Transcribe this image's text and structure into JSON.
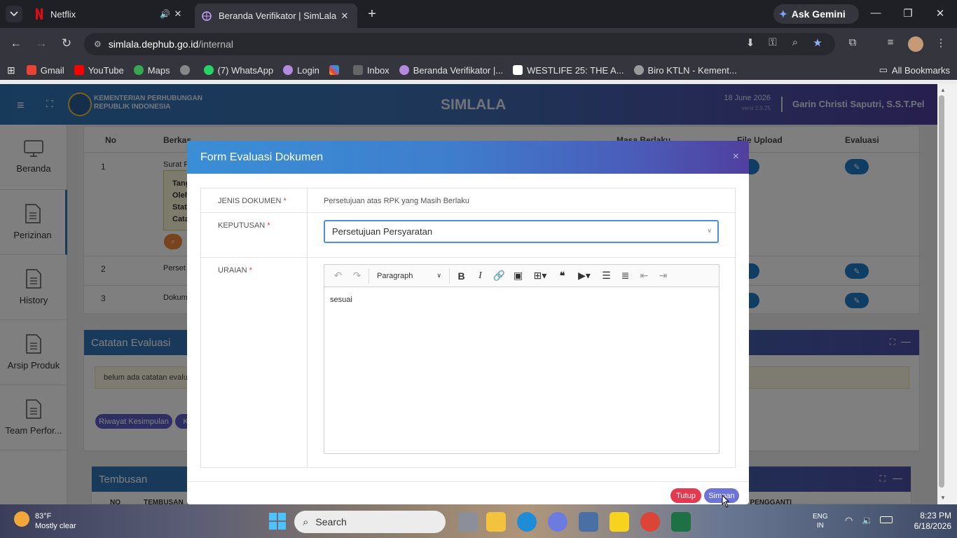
{
  "browser": {
    "tabs": [
      {
        "title": "Netflix",
        "audio": true
      },
      {
        "title": "Beranda Verifikator | SimLala",
        "active": true
      }
    ],
    "gemini_label": "Ask Gemini",
    "url_host": "simlala.dephub.go.id",
    "url_path": "/internal",
    "bookmarks": [
      "Gmail",
      "YouTube",
      "Maps",
      "",
      "(7) WhatsApp",
      "Login",
      "",
      "Inbox",
      "Beranda Verifikator |...",
      "WESTLIFE 25: THE A...",
      "Biro KTLN - Kement..."
    ],
    "all_bookmarks": "All Bookmarks"
  },
  "app": {
    "org_line1": "KEMENTERIAN PERHUBUNGAN",
    "org_line2": "REPUBLIK INDONESIA",
    "title": "SIMLALA",
    "date": "18 June 2026",
    "version": "versi 2.0.25",
    "user": "Garin Christi Saputri, S.S.T.Pel"
  },
  "sidebar": {
    "items": [
      "Beranda",
      "Perizinan",
      "History",
      "Arsip Produk",
      "Team Perfor..."
    ]
  },
  "table": {
    "headers": [
      "No",
      "Berkas",
      "Masa Berlaku",
      "File Upload",
      "Evaluasi"
    ],
    "rows": [
      {
        "no": "1",
        "berkas": "Surat P"
      },
      {
        "no": "2",
        "berkas": "Perset"
      },
      {
        "no": "3",
        "berkas": "Dokum"
      }
    ],
    "detail_lines": [
      "Tang",
      "Oleh",
      "Stat",
      "Cata"
    ]
  },
  "catatan": {
    "title": "Catatan Evaluasi",
    "note": "belum ada catatan evalu",
    "button": "Riwayat Kesimpulan",
    "button2": "K"
  },
  "tembusan": {
    "title": "Tembusan",
    "col1": "NO",
    "col2": "TEMBUSAN",
    "col3": "E PENGGANTI"
  },
  "modal": {
    "title": "Form Evaluasi Dokumen",
    "close": "×",
    "jenis_label": "JENIS DOKUMEN",
    "jenis_value": "Persetujuan atas RPK yang Masih Berlaku",
    "keputusan_label": "KEPUTUSAN",
    "keputusan_value": "Persetujuan Persyaratan",
    "uraian_label": "URAIAN",
    "uraian_text": "sesuai",
    "editor_heading": "Paragraph",
    "tutup": "Tutup",
    "simpan": "Simpan"
  },
  "taskbar": {
    "weather_temp": "83°F",
    "weather_desc": "Mostly clear",
    "search": "Search",
    "lang1": "ENG",
    "lang2": "IN",
    "time": "8:23 PM",
    "date": "6/18/2026"
  }
}
